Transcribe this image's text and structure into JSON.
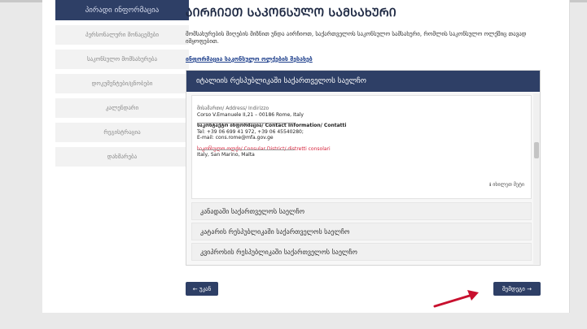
{
  "sidebar": {
    "header": "პირადი ინფორმაცია",
    "items": [
      {
        "label": "პერსონალური მონაცემები"
      },
      {
        "label": "საკონსულო მომსახურება"
      },
      {
        "label": "დოკუმენტები/ცნობები"
      },
      {
        "label": "კალენდარი"
      },
      {
        "label": "რეგისტრაცია"
      },
      {
        "label": "დახმარება"
      }
    ]
  },
  "main": {
    "title": "ᲐᲘᲠᲩᲘᲔᲗ ᲡᲐᲙᲝᲜᲡᲣᲚᲝ ᲡᲐᲛᲡᲐᲮᲣᲠᲘ",
    "intro": "მომსახურების მიღების მიზნით უნდა აირჩიოთ, საქართველოს საკონსულო სამსახური, რომლის საკონსულო ოლქშიც თავად იმყოფებით.",
    "info_link": "ინფორმაცია საკონსულო ოლქების შესახებ",
    "active_section": {
      "title": "იტალიის რესპუბლიკაში საქართველოს საელჩო",
      "address_label": "მისამართი/ Address/ Indirizzo",
      "address_value": "Corso V.Emanuele II,21 – 00186 Rome, Italy",
      "contact_label": "საკონტაქტო ინფორმაცია/ Contact Information/ Contatti",
      "tel": "Tel: +39 06 699 41 972, +39 06 45540280;",
      "email": "E-mail: cons.rome@mfa.gov.ge",
      "district_label": "საკონსულო ოლქი/ Consular District/ distretti consolari",
      "district_value": "Italy, San Marino, Malta",
      "more": "ℹ იხილეთ მეტი"
    },
    "other_sections": [
      {
        "title": "კანადაში საქართველოს საელჩო"
      },
      {
        "title": "კატარის რესპუბლიკაში საქართველოს საელჩო"
      },
      {
        "title": "კვიპროსის რესპუბლიკაში საქართველოს საელჩო"
      }
    ],
    "back_button": "← უკან",
    "next_button": "შემდეგი →"
  },
  "colors": {
    "primary": "#2e3f66",
    "annotation_arrow": "#c8102e"
  }
}
